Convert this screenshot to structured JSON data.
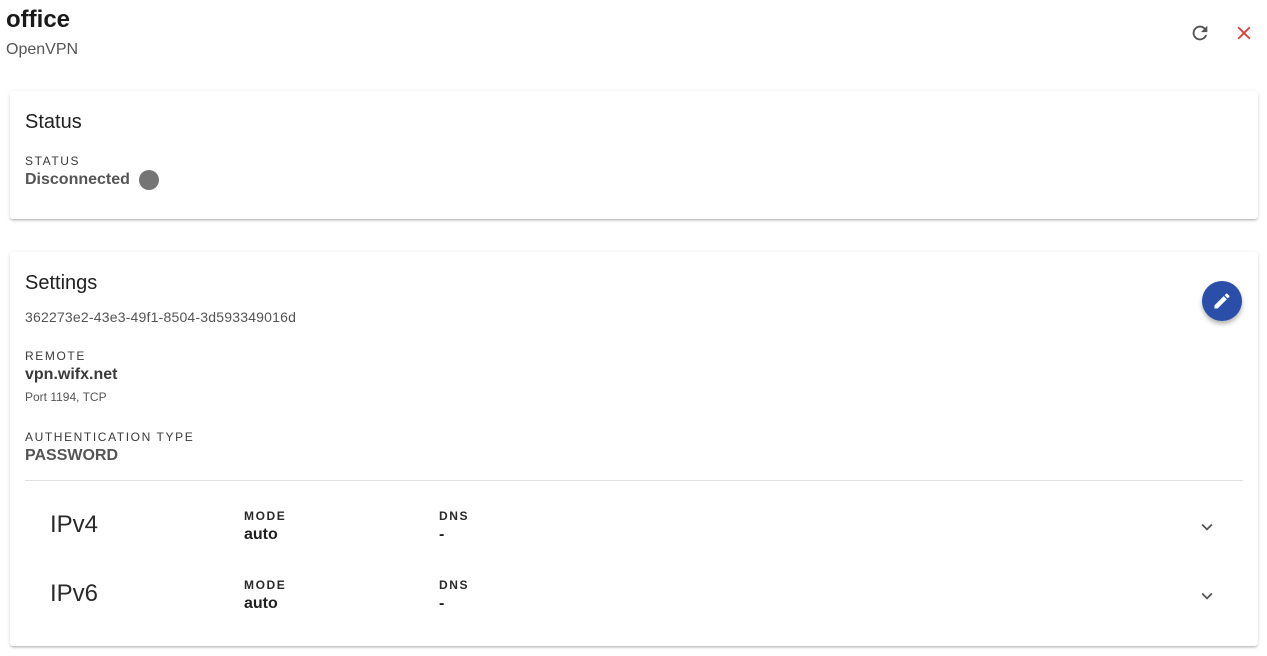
{
  "header": {
    "title": "office",
    "subtitle": "OpenVPN",
    "refresh_icon": "refresh-icon",
    "close_icon": "close-icon",
    "close_color": "#e53935"
  },
  "status_card": {
    "title": "Status",
    "status_label": "STATUS",
    "status_value": "Disconnected",
    "status_dot_color": "#757575"
  },
  "settings_card": {
    "title": "Settings",
    "uuid": "362273e2-43e3-49f1-8504-3d593349016d",
    "edit_icon": "pencil-icon",
    "edit_color": "#2b4fa8",
    "remote_label": "REMOTE",
    "remote_value": "vpn.wifx.net",
    "remote_port": "Port 1194, TCP",
    "auth_label": "AUTHENTICATION TYPE",
    "auth_value": "PASSWORD",
    "ip_rows": [
      {
        "name": "IPv4",
        "mode_label": "MODE",
        "mode_value": "auto",
        "dns_label": "DNS",
        "dns_value": "-"
      },
      {
        "name": "IPv6",
        "mode_label": "MODE",
        "mode_value": "auto",
        "dns_label": "DNS",
        "dns_value": "-"
      }
    ]
  }
}
